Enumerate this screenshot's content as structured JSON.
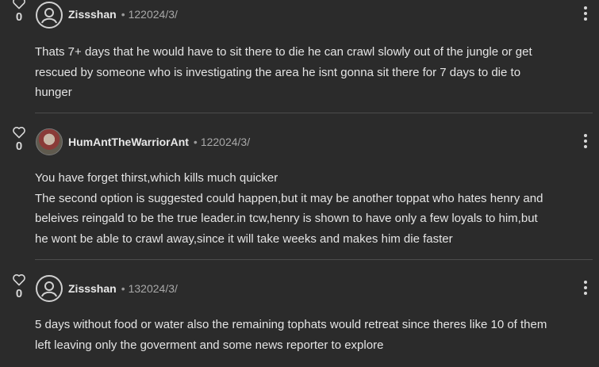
{
  "comments": [
    {
      "likes": "0",
      "author": "Zissshan",
      "separator": "•",
      "date": "122024/3/",
      "avatar": "default-user-icon",
      "lines": [
        "Thats 7+ days that he would have to sit there to die he can crawl slowly out of the jungle or get",
        "rescued by someone who is investigating the area he isnt gonna sit there for 7 days to die to",
        "hunger"
      ]
    },
    {
      "likes": "0",
      "author": "HumAntTheWarriorAnt",
      "separator": "•",
      "date": "122024/3/",
      "avatar": "profile-photo",
      "lines": [
        "You have forget thirst,which kills much quicker",
        "The second option is suggested could happen,but it may be another toppat who hates henry and",
        "beleives reingald to be the true leader.in tcw,henry is shown to have only a few loyals to him,but",
        "he wont be able to crawl away,since it will take weeks and makes him die faster"
      ]
    },
    {
      "likes": "0",
      "author": "Zissshan",
      "separator": "•",
      "date": "132024/3/",
      "avatar": "default-user-icon",
      "lines": [
        "5 days without food or water also the remaining tophats would retreat since theres like 10 of them",
        "left leaving only the goverment and some news reporter to explore"
      ]
    }
  ],
  "colors": {
    "background": "#2b2b2b",
    "text": "#e4e4e4",
    "muted": "#a8a8a8",
    "divider": "#4c4c4c"
  },
  "icons": {
    "like": "heart-outline-icon",
    "menu": "more-vertical-icon",
    "avatar_default": "user-circle-icon"
  }
}
